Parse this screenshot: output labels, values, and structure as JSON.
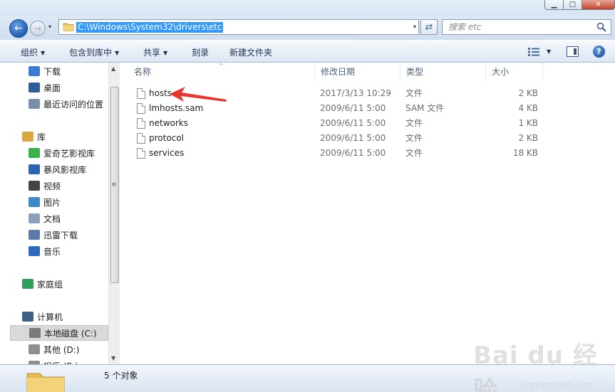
{
  "window": {
    "controls": {
      "minimize": "▁",
      "maximize": "□",
      "close": "✕"
    }
  },
  "address_bar": {
    "path": "C:\\Windows\\System32\\drivers\\etc",
    "dropdown_glyph": "▾",
    "back_glyph": "←",
    "forward_glyph": "→",
    "refresh_glyph": "⇄",
    "icon": "folder-icon"
  },
  "search": {
    "placeholder": "搜索 etc",
    "icon": "search-icon"
  },
  "toolbar": {
    "organize": "组织",
    "include_in_library": "包含到库中",
    "share": "共享",
    "burn": "刻录",
    "new_folder": "新建文件夹",
    "view_icon": "view-options-icon",
    "preview_icon": "preview-pane-icon",
    "help": "?"
  },
  "nav": {
    "items": [
      {
        "label": "下载",
        "icon": "download-folder-icon"
      },
      {
        "label": "桌面",
        "icon": "desktop-icon"
      },
      {
        "label": "最近访问的位置",
        "icon": "recent-places-icon"
      },
      {
        "label": "库",
        "icon": "library-icon"
      },
      {
        "label": "爱奇艺影视库",
        "icon": "iqiyi-library-icon"
      },
      {
        "label": "暴风影视库",
        "icon": "baofeng-library-icon"
      },
      {
        "label": "视频",
        "icon": "video-library-icon"
      },
      {
        "label": "图片",
        "icon": "picture-library-icon"
      },
      {
        "label": "文档",
        "icon": "document-library-icon"
      },
      {
        "label": "迅雷下载",
        "icon": "xunlei-download-icon"
      },
      {
        "label": "音乐",
        "icon": "music-library-icon"
      },
      {
        "label": "家庭组",
        "icon": "homegroup-icon"
      },
      {
        "label": "计算机",
        "icon": "computer-icon"
      },
      {
        "label": "本地磁盘 (C:)",
        "icon": "local-disk-icon"
      },
      {
        "label": "其他 (D:)",
        "icon": "drive-icon"
      },
      {
        "label": "娱乐 (E:)",
        "icon": "drive-icon"
      }
    ],
    "scrollbar": {
      "up": "▲",
      "down": "▼",
      "grip": "≡"
    }
  },
  "columns": {
    "name": "名称",
    "date": "修改日期",
    "type": "类型",
    "size": "大小",
    "sort_glyph": "^"
  },
  "files": [
    {
      "name": "hosts",
      "date": "2017/3/13 10:29",
      "type": "文件",
      "size": "2 KB"
    },
    {
      "name": "lmhosts.sam",
      "date": "2009/6/11 5:00",
      "type": "SAM 文件",
      "size": "4 KB"
    },
    {
      "name": "networks",
      "date": "2009/6/11 5:00",
      "type": "文件",
      "size": "1 KB"
    },
    {
      "name": "protocol",
      "date": "2009/6/11 5:00",
      "type": "文件",
      "size": "2 KB"
    },
    {
      "name": "services",
      "date": "2009/6/11 5:00",
      "type": "文件",
      "size": "18 KB"
    }
  ],
  "status": {
    "text": "5 个对象",
    "icon": "folder-icon"
  },
  "annotation": {
    "icon": "red-arrow-icon",
    "color": "#e8352e"
  },
  "watermark": {
    "brand": "Bai du 经验",
    "sub": "jingyan.baidu.com"
  }
}
